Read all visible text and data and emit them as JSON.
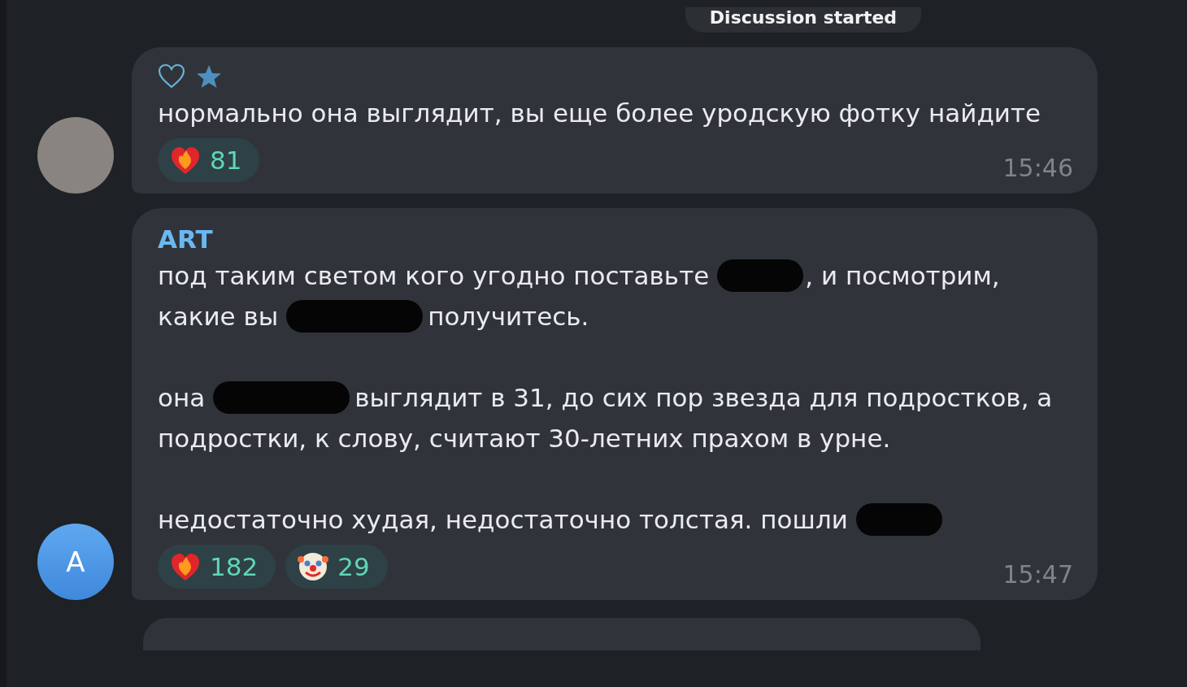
{
  "service_message": "Discussion started",
  "messages": [
    {
      "avatar": {
        "kind": "photo"
      },
      "badges": [
        {
          "kind": "heart"
        },
        {
          "kind": "star"
        }
      ],
      "paragraphs": [
        {
          "lines": [
            [
              {
                "kind": "text",
                "text": "нормально она выглядит, вы еще более уродскую фотку найдите"
              }
            ]
          ]
        }
      ],
      "reactions": [
        {
          "kind": "heartfire",
          "count": "81"
        }
      ],
      "time": "15:46"
    },
    {
      "avatar": {
        "kind": "initial",
        "initial": "A"
      },
      "sender": "ART",
      "paragraphs": [
        {
          "lines": [
            [
              {
                "kind": "text",
                "text": "под таким светом кого угодно поставьте"
              },
              {
                "kind": "redacted"
              },
              {
                "kind": "text",
                "text": ", и посмотрим,"
              }
            ],
            [
              {
                "kind": "text",
                "text": "какие вы"
              },
              {
                "kind": "redactedlong"
              },
              {
                "kind": "text",
                "text": "получитесь."
              }
            ]
          ]
        },
        {
          "lines": [
            [
              {
                "kind": "text",
                "text": "она"
              },
              {
                "kind": "redactedlong"
              },
              {
                "kind": "text",
                "text": "выглядит в 31, до сих пор звезда для подростков, а"
              }
            ],
            [
              {
                "kind": "text",
                "text": "подростки, к слову, считают 30-летних прахом в урне."
              }
            ]
          ]
        },
        {
          "lines": [
            [
              {
                "kind": "text",
                "text": "недостаточно худая, недостаточно толстая. пошли"
              },
              {
                "kind": "redacted"
              }
            ]
          ]
        }
      ],
      "reactions": [
        {
          "kind": "heartfire",
          "count": "182"
        },
        {
          "kind": "clown",
          "count": "29"
        }
      ],
      "time": "15:47"
    }
  ]
}
